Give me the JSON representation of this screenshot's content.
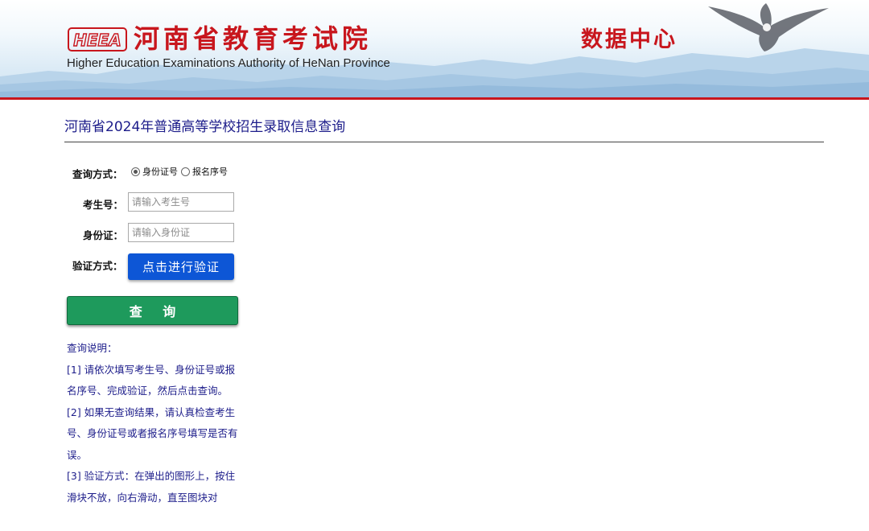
{
  "header": {
    "logo_text": "HEEA",
    "org_name": "河南省教育考试院",
    "org_name_en": "Higher Education Examinations Authority of HeNan Province",
    "center_title": "数据中心"
  },
  "page": {
    "title": "河南省2024年普通高等学校招生录取信息查询"
  },
  "form": {
    "query_method_label": "查询方式：",
    "radio_options": [
      "身份证号",
      "报名序号"
    ],
    "radio_selected": "身份证号",
    "exam_no_label": "考生号：",
    "exam_no_placeholder": "请输入考生号",
    "id_label": "身份证：",
    "id_placeholder": "请输入身份证",
    "verify_label": "验证方式：",
    "verify_button": "点击进行验证",
    "query_button": "查 询"
  },
  "notes": {
    "heading": "查询说明：",
    "items": [
      "[1] 请依次填写考生号、身份证号或报名序号、完成验证，然后点击查询。",
      "[2] 如果无查询结果，请认真检查考生号、身份证号或者报名序号填写是否有误。",
      "[3] 验证方式：在弹出的图形上，按住滑块不放，向右滑动，直至图块对"
    ]
  },
  "colors": {
    "brand_red": "#c8161d",
    "verify_blue": "#0d56d6",
    "query_green": "#1e9a5c",
    "title_navy": "#1c1c8a"
  }
}
